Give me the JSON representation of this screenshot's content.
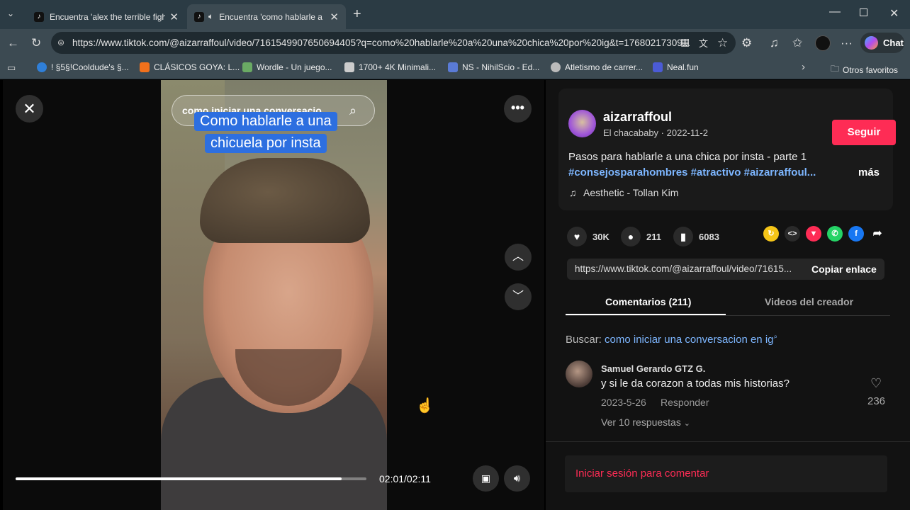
{
  "browser": {
    "tabs": [
      {
        "title": "Encuentra 'alex the terrible fight' c",
        "active": false
      },
      {
        "title": "Encuentra 'como hablarle a u",
        "active": true
      }
    ],
    "url": "https://www.tiktok.com/@aizarraffoul/video/7161549907650694405?q=como%20hablarle%20a%20una%20chica%20por%20ig&t=17680217309...",
    "chat_label": "Chat",
    "favorites": [
      {
        "label": "! §5§!Cooldude's §...",
        "color": "#2f7fd8"
      },
      {
        "label": "CLÁSICOS GOYA: L...",
        "color": "#f2711c"
      },
      {
        "label": "Wordle - Un juego...",
        "color": "#6aaa64"
      },
      {
        "label": "1700+ 4K Minimali...",
        "color": "#cccccc"
      },
      {
        "label": "NS - NihilScio - Ed...",
        "color": "#5a7bd6"
      },
      {
        "label": "Atletismo de carrer...",
        "color": "#bbbbbb"
      },
      {
        "label": "Neal.fun",
        "color": "#4b5bd6"
      }
    ],
    "other_favorites": "Otros favoritos"
  },
  "video": {
    "search_text": "como iniciar una conversacio...",
    "caption_line1": "Como hablarle a una",
    "caption_line2": "chicuela por insta",
    "time": "02:01/02:11",
    "progress": 0.93
  },
  "post": {
    "username": "aizarraffoul",
    "nickname": "El chacababy",
    "date": "2022-11-2",
    "follow_label": "Seguir",
    "description": "Pasos para hablarle a una chica por insta - parte 1",
    "hashtags": "#consejosparahombres #atractivo #aizarraffoul...",
    "more_label": "más",
    "music": "Aesthetic - Tollan Kim",
    "likes": "30K",
    "comments": "211",
    "saves": "6083",
    "link": "https://www.tiktok.com/@aizarraffoul/video/71615...",
    "copy_label": "Copiar enlace",
    "tab_comments": "Comentarios (211)",
    "tab_videos": "Videos del creador",
    "search_prefix": "Buscar:",
    "search_query": "como iniciar una conversacion en ig",
    "login_label": "Iniciar sesión para comentar"
  },
  "comment": {
    "author": "Samuel Gerardo GTZ G.",
    "text": "y si le da corazon a todas mis historias?",
    "date": "2023-5-26",
    "reply_label": "Responder",
    "likes": "236",
    "view_replies": "Ver 10 respuestas"
  },
  "colors": {
    "accent": "#fe2c55",
    "link": "#7db6ff"
  }
}
